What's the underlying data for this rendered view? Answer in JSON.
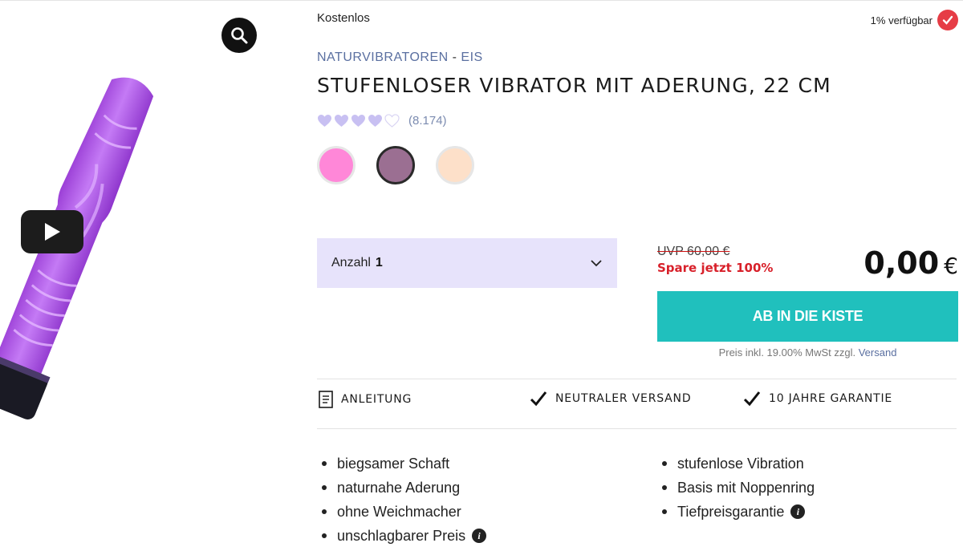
{
  "gallery": {
    "zoom_icon": "search-icon",
    "play_icon": "play-icon",
    "product_color": "#b45ee8"
  },
  "product": {
    "shipping_label": "Kostenlos",
    "stock_label": "1% verfügbar",
    "breadcrumb": {
      "category": "NATURVIBRATOREN",
      "separator": "-",
      "subcategory": "EIS"
    },
    "title": "STUFENLOSER VIBRATOR MIT ADERUNG, 22 CM",
    "rating": {
      "hearts_filled": 4,
      "hearts_total": 5,
      "count": "(8.174)"
    },
    "colors": [
      {
        "name": "pink",
        "hex": "#ff87d8",
        "selected": false
      },
      {
        "name": "mauve",
        "hex": "#9b6f92",
        "selected": true
      },
      {
        "name": "skin",
        "hex": "#fde0c9",
        "selected": false
      }
    ]
  },
  "purchase": {
    "quantity_label": "Anzahl",
    "quantity_value": "1",
    "uvp": "UVP 60,00 €",
    "savings": "Spare jetzt 100%",
    "price": "0,00",
    "currency": "€",
    "cart_button": "AB IN DIE KISTE",
    "tax_text": "Preis inkl. 19.00% MwSt zzgl.",
    "shipping_link": "Versand"
  },
  "features": [
    {
      "icon": "document-icon",
      "label": "ANLEITUNG"
    },
    {
      "icon": "check-icon",
      "label": "NEUTRALER VERSAND"
    },
    {
      "icon": "check-icon",
      "label": "10 JAHRE GARANTIE"
    }
  ],
  "bullets_left": [
    "biegsamer Schaft",
    "naturnahe Aderung",
    "ohne Weichmacher",
    "unschlagbarer Preis"
  ],
  "bullets_right": [
    "stufenlose Vibration",
    "Basis mit Noppenring",
    "Tiefpreisgarantie"
  ],
  "colors": {
    "accent_teal": "#20c0bd",
    "qty_bg": "#e7e3fb",
    "sale_red": "#d8202a",
    "link_blue": "#5a6fa0"
  }
}
